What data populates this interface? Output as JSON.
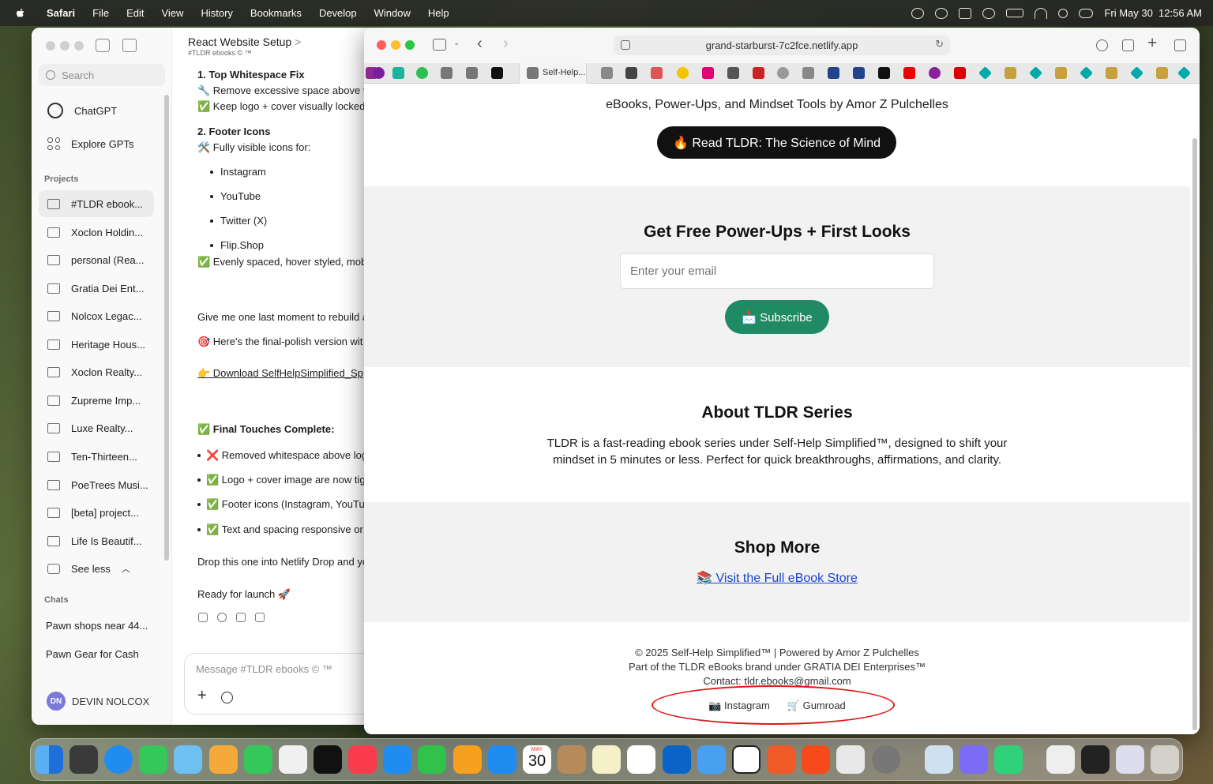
{
  "menubar": {
    "app": "Safari",
    "items": [
      "File",
      "Edit",
      "View",
      "History",
      "Bookmarks",
      "Develop",
      "Window",
      "Help"
    ],
    "datetime": "Fri May 30  12:56 AM"
  },
  "chatgpt": {
    "search_placeholder": "Search",
    "nav": {
      "chatgpt": "ChatGPT",
      "explore": "Explore GPTs"
    },
    "projects_heading": "Projects",
    "projects": [
      "#TLDR ebook...",
      "Xoclon Holdin...",
      "personal (Rea...",
      "Gratia Dei Ent...",
      "Nolcox Legac...",
      "Heritage Hous...",
      "Xoclon Realty...",
      "Zupreme Imp...",
      "Luxe Realty...",
      "Ten-Thirteen...",
      "PoeTrees Musi...",
      "[beta] project...",
      "Life Is Beautif..."
    ],
    "see_less": "See less",
    "chats_heading": "Chats",
    "chats": [
      "Pawn shops near 44...",
      "Pawn Gear for Cash"
    ],
    "user": {
      "initials": "DN",
      "name": "DEVIN NOLCOX"
    },
    "conversation": {
      "title": "React Website Setup",
      "title_chevron": ">",
      "subtitle": "#TLDR ebooks  © ™",
      "lines": {
        "l1": "1.  Top Whitespace Fix",
        "l2": "🔧 Remove excessive space above th",
        "l3": "✅ Keep logo + cover visually locked",
        "l4": "2.  Footer Icons",
        "l5": "🛠️ Fully visible icons for:",
        "b1": "Instagram",
        "b2": "YouTube",
        "b3": "Twitter (X)",
        "b4": "Flip.Shop",
        "l6": "✅ Evenly spaced, hover styled, mob",
        "l7": "Give me one last moment to rebuild a",
        "l8": "🎯 Here's the final-polish version wit",
        "l9": "👉 Download SelfHelpSimplified_Sp",
        "l10": "✅ Final Touches Complete:",
        "c1": "❌ Removed whitespace above log",
        "c2": "✅ Logo + cover image are now tig",
        "c3": "✅ Footer icons (Instagram, YouTu",
        "c4": "✅ Text and spacing responsive or",
        "l11": "Drop this one into Netlify Drop and yo",
        "l12": "Ready for launch 🚀"
      },
      "message_placeholder": "Message #TLDR ebooks  © ™"
    }
  },
  "safari": {
    "url": "grand-starburst-7c2fce.netlify.app",
    "active_tab_label": "Self-Help...",
    "page": {
      "tagline": "eBooks, Power-Ups, and Mindset Tools by Amor Z Pulchelles",
      "cta": "🔥 Read TLDR: The Science of Mind",
      "signup_heading": "Get Free Power-Ups + First Looks",
      "email_placeholder": "Enter your email",
      "subscribe": "📩 Subscribe",
      "about_heading": "About TLDR Series",
      "about_text": "TLDR is a fast-reading ebook series under Self-Help Simplified™, designed to shift your mindset in 5 minutes or less. Perfect for quick breakthroughs, affirmations, and clarity.",
      "shop_heading": "Shop More",
      "shop_link": "📚 Visit the Full eBook Store",
      "footer_line1": "© 2025 Self-Help Simplified™ | Powered by Amor Z Pulchelles",
      "footer_line2": "Part of the TLDR eBooks brand under GRATIA DEI Enterprises™",
      "footer_line3": "Contact: tldr.ebooks@gmail.com",
      "footer_links": [
        "📷 Instagram",
        "🛒 Gumroad"
      ]
    }
  },
  "dock": {
    "calendar_month": "MAY",
    "calendar_day": "30"
  },
  "colors": {
    "accent_green": "#1f8a63",
    "annotation_red": "#e01818",
    "link_blue": "#1a44c9"
  }
}
